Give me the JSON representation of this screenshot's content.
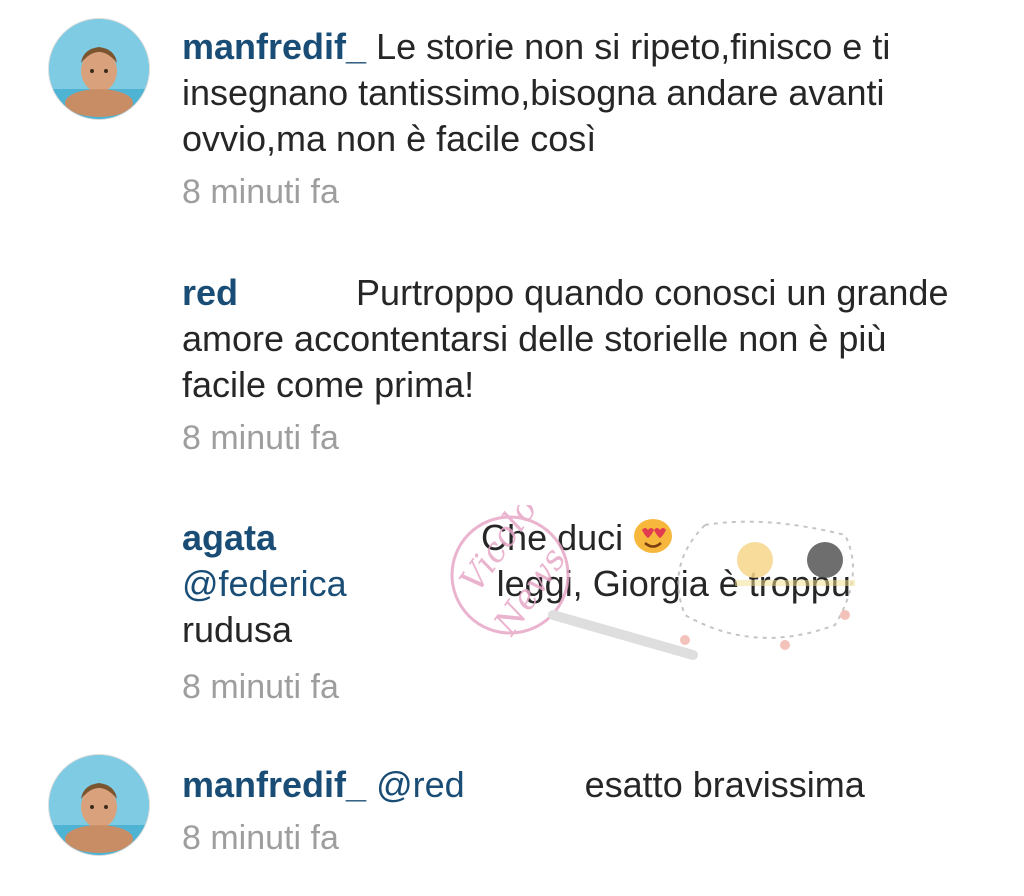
{
  "comments": [
    {
      "username": "manfredif_",
      "mention": "",
      "text": "Le storie non si ripeto,finisco e ti insegnano tantissimo,bisogna andare avanti ovvio,ma non è facile così",
      "time": "8 minuti fa",
      "has_avatar": true
    },
    {
      "username": "red",
      "mention": "",
      "text": "Purtroppo quando conosci un grande amore accontentarsi delle storielle non è più facile come prima!",
      "time": "8 minuti fa",
      "has_avatar": false
    },
    {
      "username": "agata",
      "text_line1": "Che duci",
      "mention": "@federica",
      "text_line2": "leggi, Giorgia è troppu rudusa",
      "time": "8 minuti fa",
      "has_avatar": false,
      "emoji": "heart-eyes-emoji"
    },
    {
      "username": "manfredif_",
      "mention": "@red",
      "text": "esatto bravissima",
      "time": "8 minuti fa",
      "has_avatar": true
    }
  ],
  "watermark": {
    "text_line1": "Vicolo",
    "text_line2": "News",
    "color": "#e7a7c7"
  },
  "colors": {
    "username": "#1a4d75",
    "body_text": "#262626",
    "timestamp": "#9e9e9e"
  }
}
